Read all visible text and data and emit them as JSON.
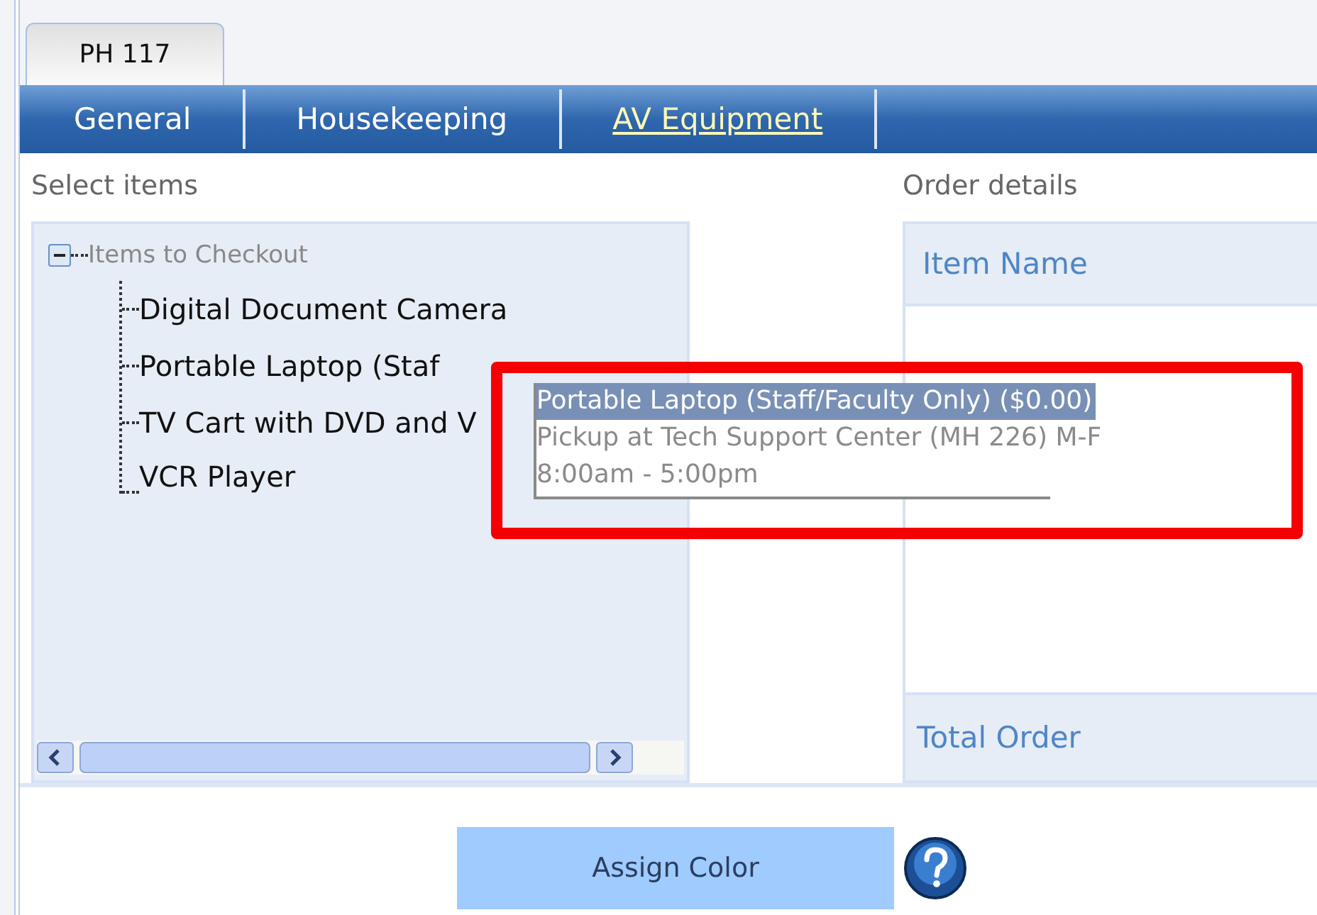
{
  "room_tab": {
    "label": "PH 117",
    "selected": true
  },
  "nav_tabs": [
    {
      "label": "General",
      "selected": false
    },
    {
      "label": "Housekeeping",
      "selected": false
    },
    {
      "label": "AV Equipment",
      "selected": true
    }
  ],
  "select_items": {
    "heading": "Select items",
    "tree": {
      "label": "Items to Checkout",
      "expanded": true,
      "children": [
        {
          "label": "Digital Document Camera"
        },
        {
          "label": "Portable Laptop (Staf"
        },
        {
          "label": "TV Cart with DVD and V"
        },
        {
          "label": "VCR Player"
        }
      ]
    }
  },
  "order_details": {
    "heading": "Order details",
    "item_name_header": "Item Name",
    "total_label": "Total Order"
  },
  "tooltip": {
    "lines": [
      {
        "text": "Portable Laptop (Staff/Faculty Only)   ($0.00)",
        "selected": true
      },
      {
        "text": "Pickup at Tech Support Center (MH 226) M-F",
        "selected": false
      },
      {
        "text": "8:00am - 5:00pm",
        "selected": false
      }
    ]
  },
  "assign_button": "Assign Color"
}
